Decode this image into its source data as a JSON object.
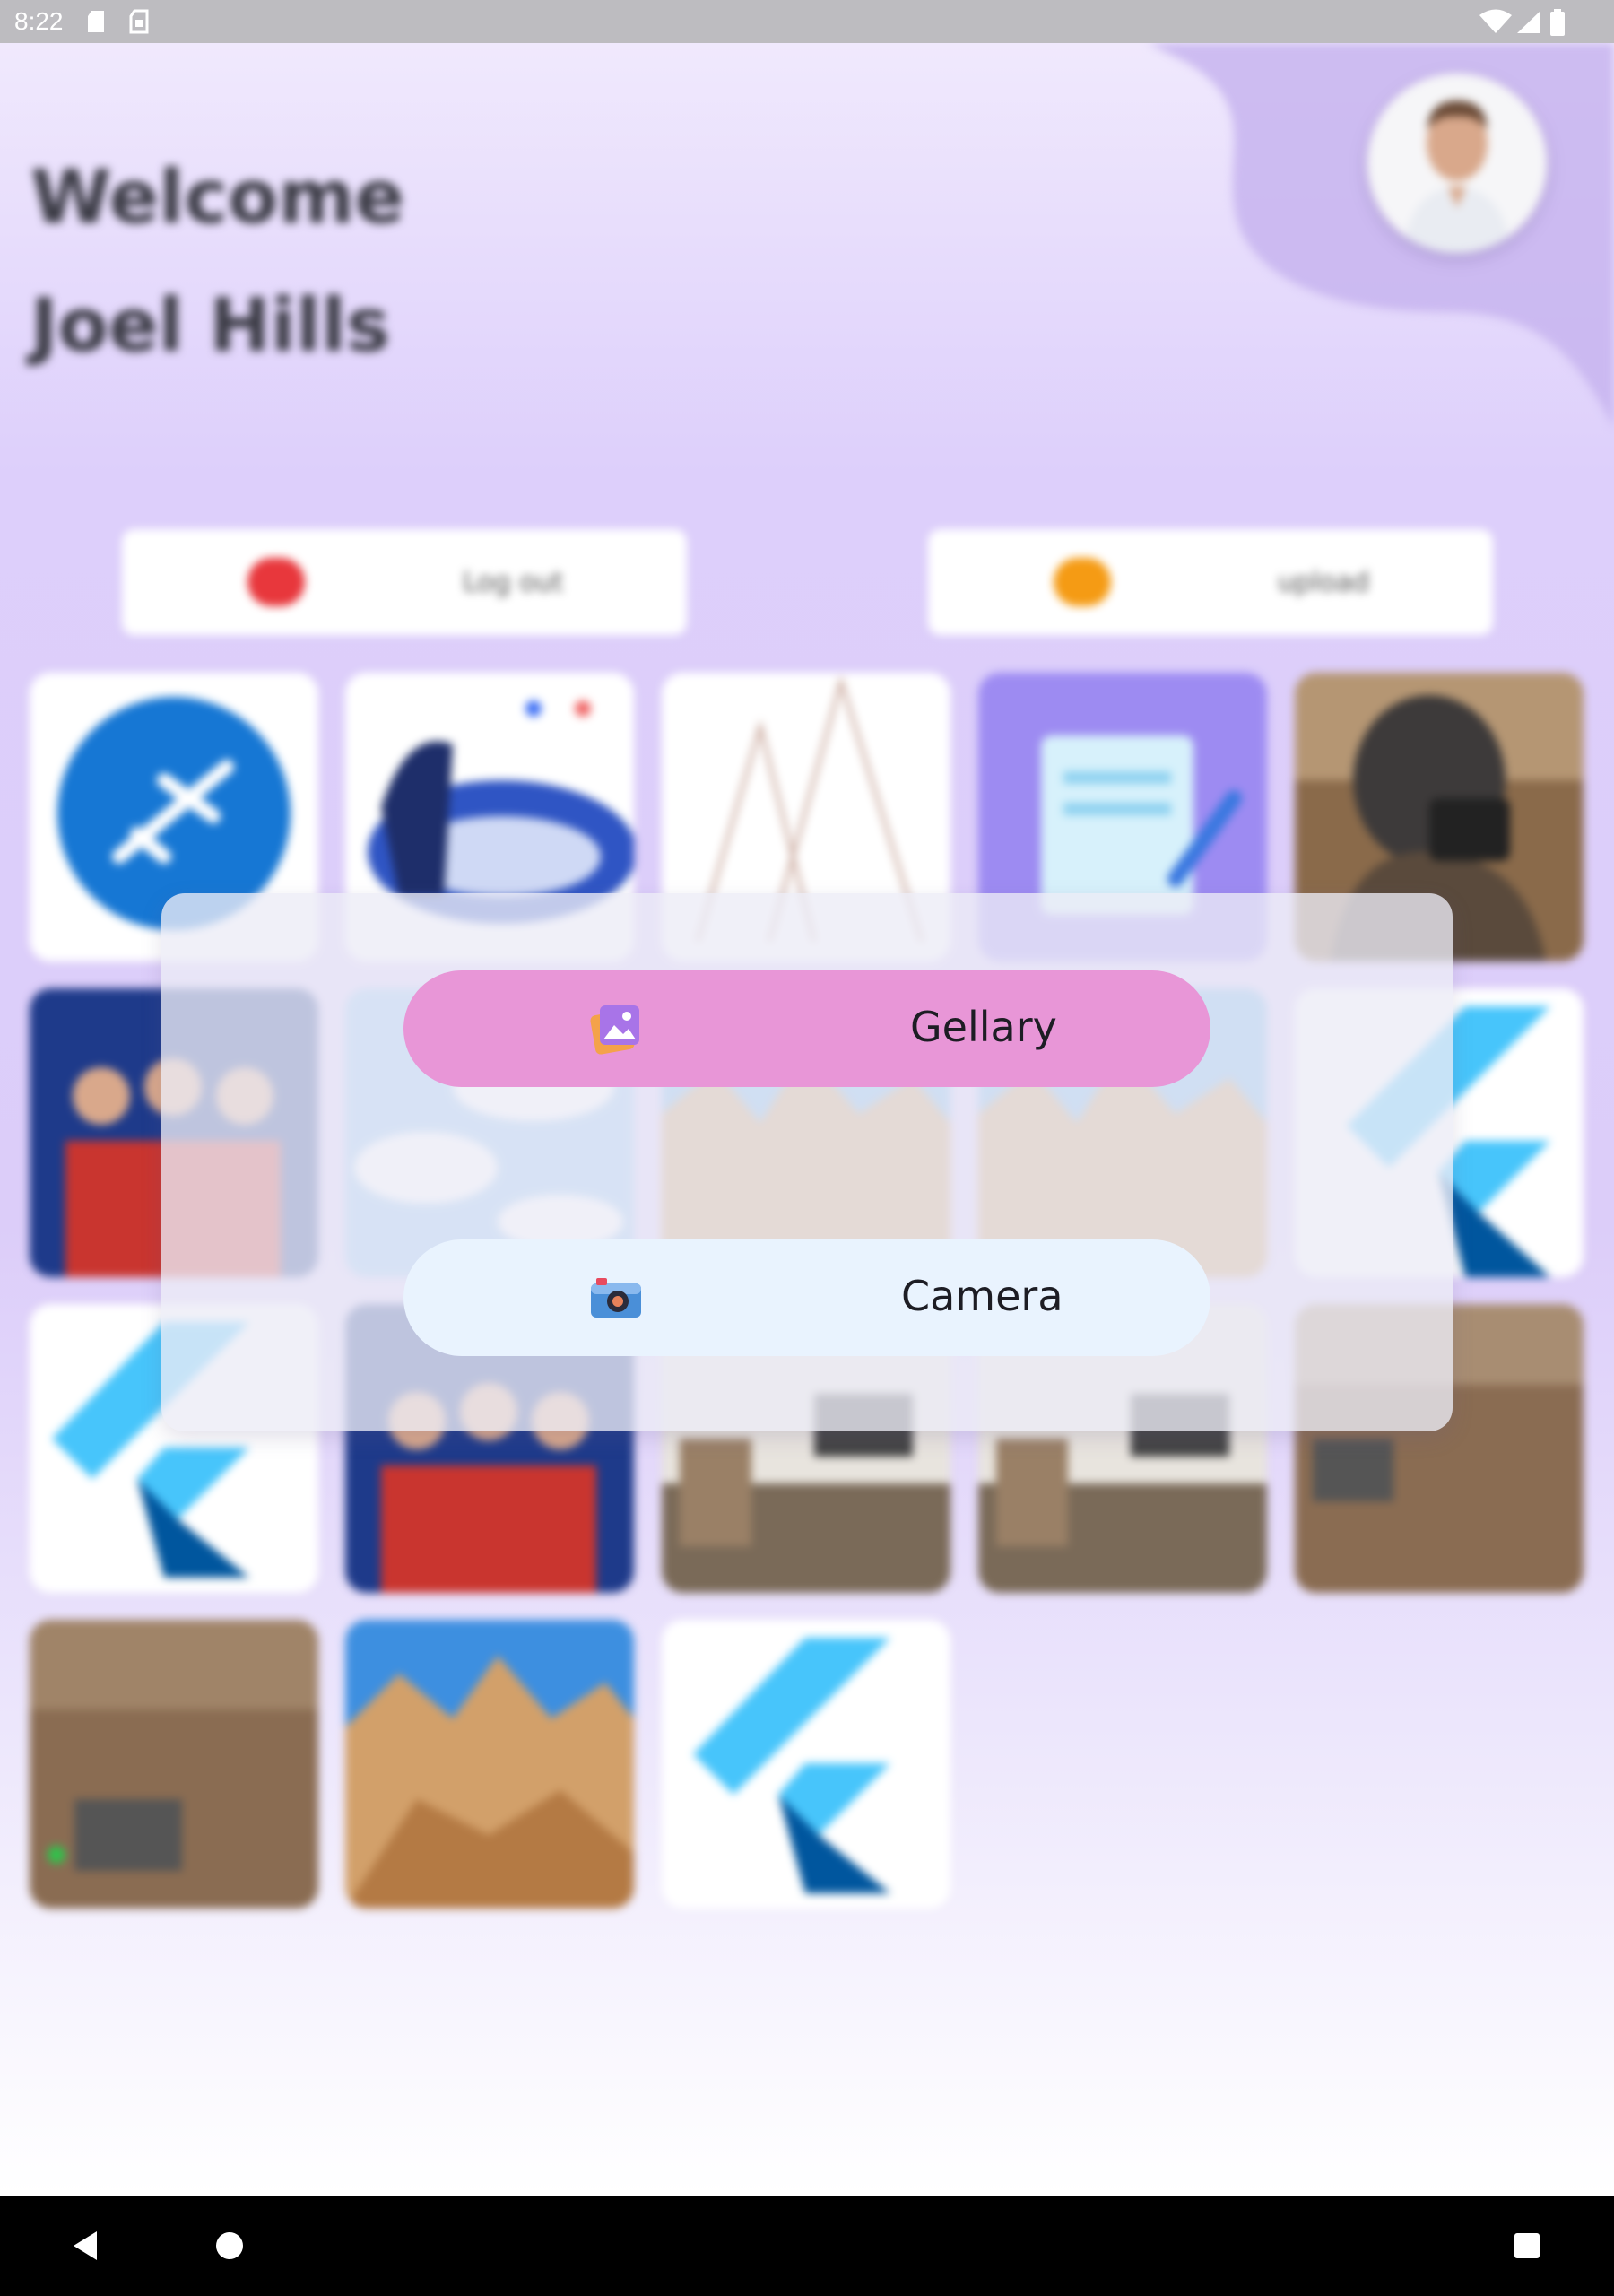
{
  "status_bar": {
    "time": "8:22",
    "icons": [
      "sd-card-icon",
      "sim-icon",
      "wifi-icon",
      "signal-icon",
      "battery-icon"
    ]
  },
  "header": {
    "greeting": "Welcome",
    "user_name": "Joel Hills"
  },
  "actions": {
    "logout_label": "Log out",
    "upload_label": "upload",
    "logout_color": "#e8373c",
    "upload_color": "#f59b14"
  },
  "gallery": {
    "images": [
      "airplane-logo",
      "travel-illustration",
      "sketch-mountains",
      "note-app-icon",
      "photographer-photo",
      "team-photo",
      "clouds-photo",
      "desert-canyon-photo",
      "desert-canyon-photo",
      "flutter-logo",
      "flutter-logo",
      "team-photo",
      "room-interior-photo",
      "room-interior-photo",
      "room-interior-photo",
      "room-interior-photo",
      "desert-canyon-photo",
      "flutter-logo"
    ]
  },
  "dialog": {
    "gallery_label": "Gellary",
    "camera_label": "Camera",
    "gallery_color": "#e896d7",
    "camera_color": "#e9f3fe"
  },
  "nav_bar": {
    "buttons": [
      "back-icon",
      "home-icon",
      "recents-icon"
    ]
  }
}
